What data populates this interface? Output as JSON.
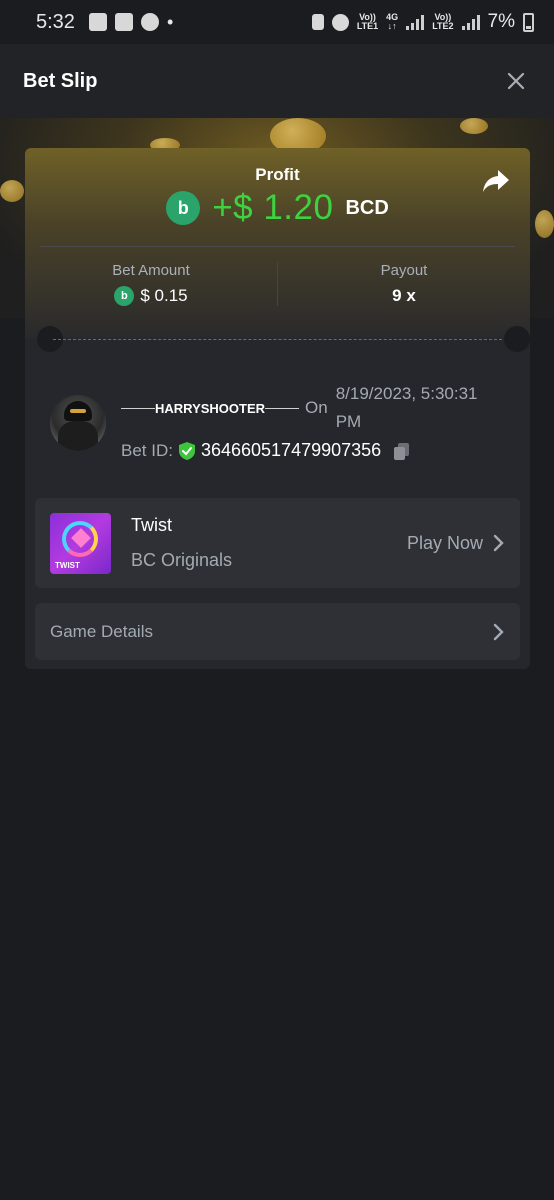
{
  "status_bar": {
    "time": "5:32",
    "dot": "•",
    "net1_top": "Vo))",
    "net1_bottom": "LTE1",
    "net_type": "4G",
    "net2_top": "Vo))",
    "net2_bottom": "LTE2",
    "battery": "7%"
  },
  "header": {
    "title": "Bet Slip"
  },
  "profit": {
    "label": "Profit",
    "value": "+$ 1.20",
    "currency": "BCD",
    "coin_glyph": "b"
  },
  "stats": {
    "bet_amount_label": "Bet Amount",
    "bet_amount_value": "$ 0.15",
    "payout_label": "Payout",
    "payout_value": "9 x"
  },
  "player": {
    "name": "HARRYSHOOTER",
    "on": "On",
    "date": "8/19/2023, 5:30:31 PM",
    "bet_id_label": "Bet ID:",
    "bet_id": "364660517479907356"
  },
  "game": {
    "thumb_text": "TWIST",
    "name": "Twist",
    "provider": "BC Originals",
    "play_label": "Play Now"
  },
  "details": {
    "label": "Game Details"
  },
  "colors": {
    "background": "#1b1c1f",
    "profit_green": "#3ed140",
    "coin_green": "#2aa46b",
    "card": "#25272c"
  }
}
